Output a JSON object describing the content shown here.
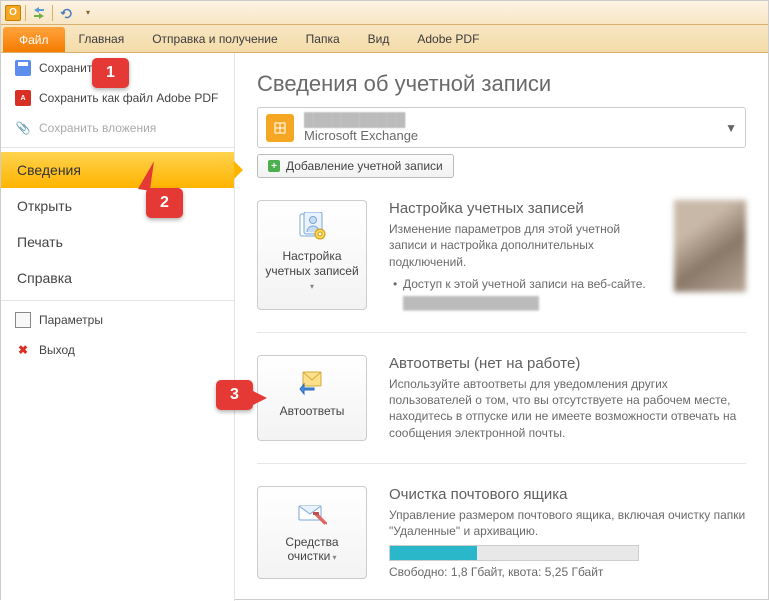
{
  "app_icon_letter": "O",
  "ribbon": {
    "file": "Файл",
    "tabs": [
      "Главная",
      "Отправка и получение",
      "Папка",
      "Вид",
      "Adobe PDF"
    ]
  },
  "sidebar": {
    "save": "Сохранить",
    "save_pdf": "Сохранить как файл Adobe PDF",
    "save_attachments": "Сохранить вложения",
    "nav": {
      "info": "Сведения",
      "open": "Открыть",
      "print": "Печать",
      "help": "Справка"
    },
    "options": "Параметры",
    "exit": "Выход"
  },
  "content": {
    "title": "Сведения об учетной записи",
    "account": {
      "type": "Microsoft Exchange"
    },
    "add_account": "Добавление учетной записи",
    "sec1": {
      "btn": "Настройка учетных записей",
      "title": "Настройка учетных записей",
      "desc": "Изменение параметров для этой учетной записи и настройка дополнительных подключений.",
      "bullet": "Доступ к этой учетной записи на веб-сайте."
    },
    "sec2": {
      "btn": "Автоответы",
      "title": "Автоответы (нет на работе)",
      "desc": "Используйте автоответы для уведомления других пользователей о том, что вы отсутствуете на рабочем месте, находитесь в отпуске или не имеете возможности отвечать на сообщения электронной почты."
    },
    "sec3": {
      "btn": "Средства очистки",
      "title": "Очистка почтового ящика",
      "desc": "Управление размером почтового ящика, включая очистку папки \"Удаленные\" и архивацию.",
      "quota": "Свободно: 1,8 Гбайт, квота: 5,25 Гбайт"
    }
  },
  "callouts": {
    "c1": "1",
    "c2": "2",
    "c3": "3"
  }
}
